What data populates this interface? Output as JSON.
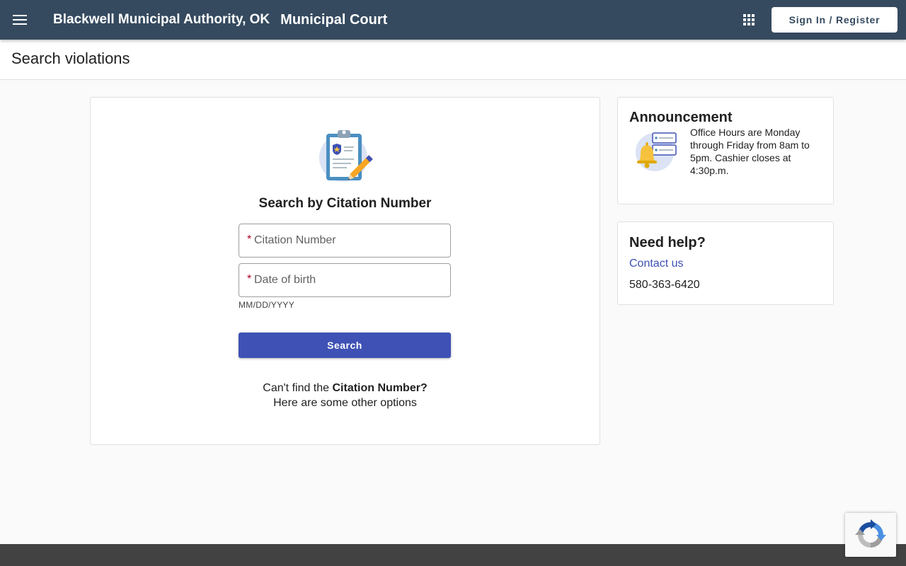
{
  "header": {
    "org_name": "Blackwell Municipal Authority, OK",
    "court_name": "Municipal Court",
    "menu_icon": "hamburger-menu-icon",
    "apps_icon": "apps-grid-icon",
    "signin_label": "Sign In / Register"
  },
  "subheader": {
    "title": "Search violations"
  },
  "search": {
    "illustration": "clipboard-pen-icon",
    "heading": "Search by Citation Number",
    "citation_required": "*",
    "citation_placeholder": "Citation Number",
    "dob_required": "*",
    "dob_placeholder": "Date of birth",
    "dob_hint": "MM/DD/YYYY",
    "button_label": "Search",
    "help_prefix": "Can't find the ",
    "help_bold": "Citation Number?",
    "help_link": "Here are some other options"
  },
  "announcement": {
    "title": "Announcement",
    "icon": "bell-notification-icon",
    "text": "Office Hours are Monday through Friday from 8am to 5pm. Cashier closes at 4:30p.m."
  },
  "help": {
    "title": "Need help?",
    "contact_label": "Contact us",
    "phone": "580-363-6420"
  },
  "colors": {
    "header_bg": "#354a5f",
    "primary": "#3f51b5",
    "required": "#b00020",
    "footer_bg": "#424242"
  }
}
